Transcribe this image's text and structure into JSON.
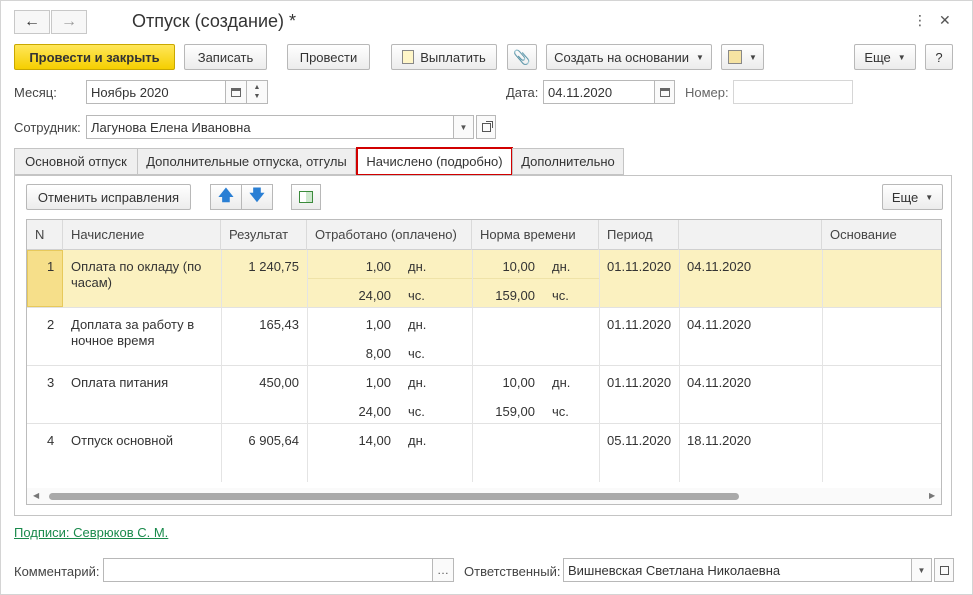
{
  "window": {
    "title": "Отпуск (создание) *"
  },
  "toolbar": {
    "post_close": "Провести и закрыть",
    "save": "Записать",
    "post": "Провести",
    "pay": "Выплатить",
    "create_based": "Создать на основании",
    "more": "Еще",
    "help": "?"
  },
  "form": {
    "month_label": "Месяц:",
    "month_value": "Ноябрь 2020",
    "date_label": "Дата:",
    "date_value": "04.11.2020",
    "number_label": "Номер:",
    "number_value": "",
    "employee_label": "Сотрудник:",
    "employee_value": "Лагунова Елена Ивановна"
  },
  "tabs": [
    {
      "label": "Основной отпуск"
    },
    {
      "label": "Дополнительные отпуска, отгулы"
    },
    {
      "label": "Начислено (подробно)"
    },
    {
      "label": "Дополнительно"
    }
  ],
  "panel": {
    "cancel_corrections": "Отменить исправления",
    "more": "Еще"
  },
  "table": {
    "columns": [
      "N",
      "Начисление",
      "Результат",
      "Отработано (оплачено)",
      "Норма времени",
      "Период",
      "",
      "Основание"
    ],
    "rows": [
      {
        "n": "1",
        "accrual": "Оплата по окладу (по часам)",
        "result": "1 240,75",
        "worked1": "1,00",
        "unit1": "дн.",
        "worked2": "24,00",
        "unit2": "чс.",
        "norm1": "10,00",
        "nunit1": "дн.",
        "norm2": "159,00",
        "nunit2": "чс.",
        "from": "01.11.2020",
        "to": "04.11.2020",
        "basis": ""
      },
      {
        "n": "2",
        "accrual": "Доплата за работу в ночное время",
        "result": "165,43",
        "worked1": "1,00",
        "unit1": "дн.",
        "worked2": "8,00",
        "unit2": "чс.",
        "norm1": "",
        "nunit1": "",
        "norm2": "",
        "nunit2": "",
        "from": "01.11.2020",
        "to": "04.11.2020",
        "basis": ""
      },
      {
        "n": "3",
        "accrual": "Оплата питания",
        "result": "450,00",
        "worked1": "1,00",
        "unit1": "дн.",
        "worked2": "24,00",
        "unit2": "чс.",
        "norm1": "10,00",
        "nunit1": "дн.",
        "norm2": "159,00",
        "nunit2": "чс.",
        "from": "01.11.2020",
        "to": "04.11.2020",
        "basis": ""
      },
      {
        "n": "4",
        "accrual": "Отпуск основной",
        "result": "6 905,64",
        "worked1": "14,00",
        "unit1": "дн.",
        "worked2": "",
        "unit2": "",
        "norm1": "",
        "nunit1": "",
        "norm2": "",
        "nunit2": "",
        "from": "05.11.2020",
        "to": "18.11.2020",
        "basis": ""
      }
    ]
  },
  "footer": {
    "signatures_link": "Подписи: Севрюков С. М.",
    "comment_label": "Комментарий:",
    "comment_value": "",
    "responsible_label": "Ответственный:",
    "responsible_value": "Вишневская Светлана Николаевна"
  },
  "colors": {
    "primary_button": "#f5cf00",
    "selected_row": "#fbf1c0",
    "active_tab_border": "#d10000",
    "link": "#1a8a4c"
  }
}
